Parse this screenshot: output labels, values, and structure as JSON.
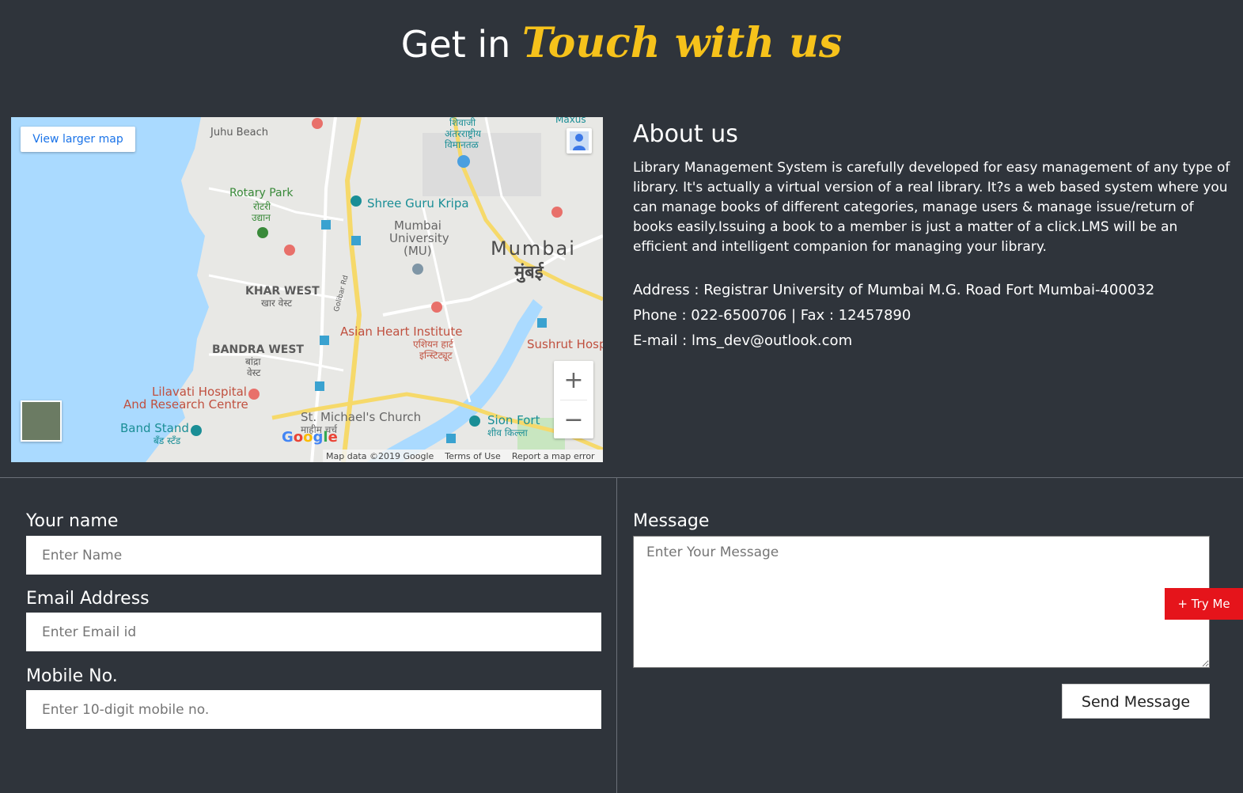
{
  "heading": {
    "plain": "Get in",
    "accent": "Touch with us"
  },
  "map": {
    "view_larger": "View larger map",
    "labels": {
      "juhu_beach": "Juhu Beach",
      "maxus": "Maxus",
      "shivaji_l1": "शिवाजी",
      "shivaji_l2": "अंतरराष्ट्रीय",
      "shivaji_l3": "विमानतळ",
      "rotary_park": "Rotary Park",
      "rotary_hi_1": "रोटरी",
      "rotary_hi_2": "उद्यान",
      "shree_guru": "Shree Guru Kripa",
      "mumbai_univ_1": "Mumbai",
      "mumbai_univ_2": "University",
      "mumbai_univ_3": "(MU)",
      "mumbai": "Mumbai",
      "mumbai_hi": "मुंबई",
      "khar_west": "KHAR WEST",
      "khar_west_hi": "खार वेस्ट",
      "gulbai_rd": "Golibar Rd",
      "asian_heart": "Asian Heart Institute",
      "asian_heart_hi_1": "एशियन हार्ट",
      "asian_heart_hi_2": "इन्स्टिट्यूट",
      "sushrut": "Sushrut Hosp",
      "bandra_west": "BANDRA WEST",
      "bandra_hi_1": "बांद्रा",
      "bandra_hi_2": "वेस्ट",
      "lilavati_1": "Lilavati Hospital",
      "lilavati_2": "And Research Centre",
      "st_michael": "St. Michael's Church",
      "st_michael_hi": "माहीम चर्च",
      "sion_fort": "Sion Fort",
      "sion_fort_hi": "शीव किल्ला",
      "band_stand": "Band Stand",
      "band_stand_hi": "बँड स्टँड"
    },
    "google": "Google",
    "zoom_in": "+",
    "zoom_out": "−",
    "footer": {
      "data": "Map data ©2019 Google",
      "terms": "Terms of Use",
      "report": "Report a map error"
    }
  },
  "about": {
    "title": "About us",
    "description": "Library Management System is carefully developed for easy management of any type of library. It's actually a virtual version of a real library. It?s a web based system where you can manage books of different categories, manage users & manage issue/return of books easily.Issuing a book to a member is just a matter of a click.LMS will be an efficient and intelligent companion for managing your library.",
    "address": "Address : Registrar University of Mumbai M.G. Road Fort Mumbai-400032",
    "phone": "Phone : 022-6500706 | Fax : 12457890",
    "email": "E-mail : lms_dev@outlook.com"
  },
  "form": {
    "name_label": "Your name",
    "name_placeholder": "Enter Name",
    "email_label": "Email Address",
    "email_placeholder": "Enter Email id",
    "mobile_label": "Mobile No.",
    "mobile_placeholder": "Enter 10-digit mobile no.",
    "message_label": "Message",
    "message_placeholder": "Enter Your Message",
    "send_label": "Send Message"
  },
  "try_me": "+ Try Me"
}
